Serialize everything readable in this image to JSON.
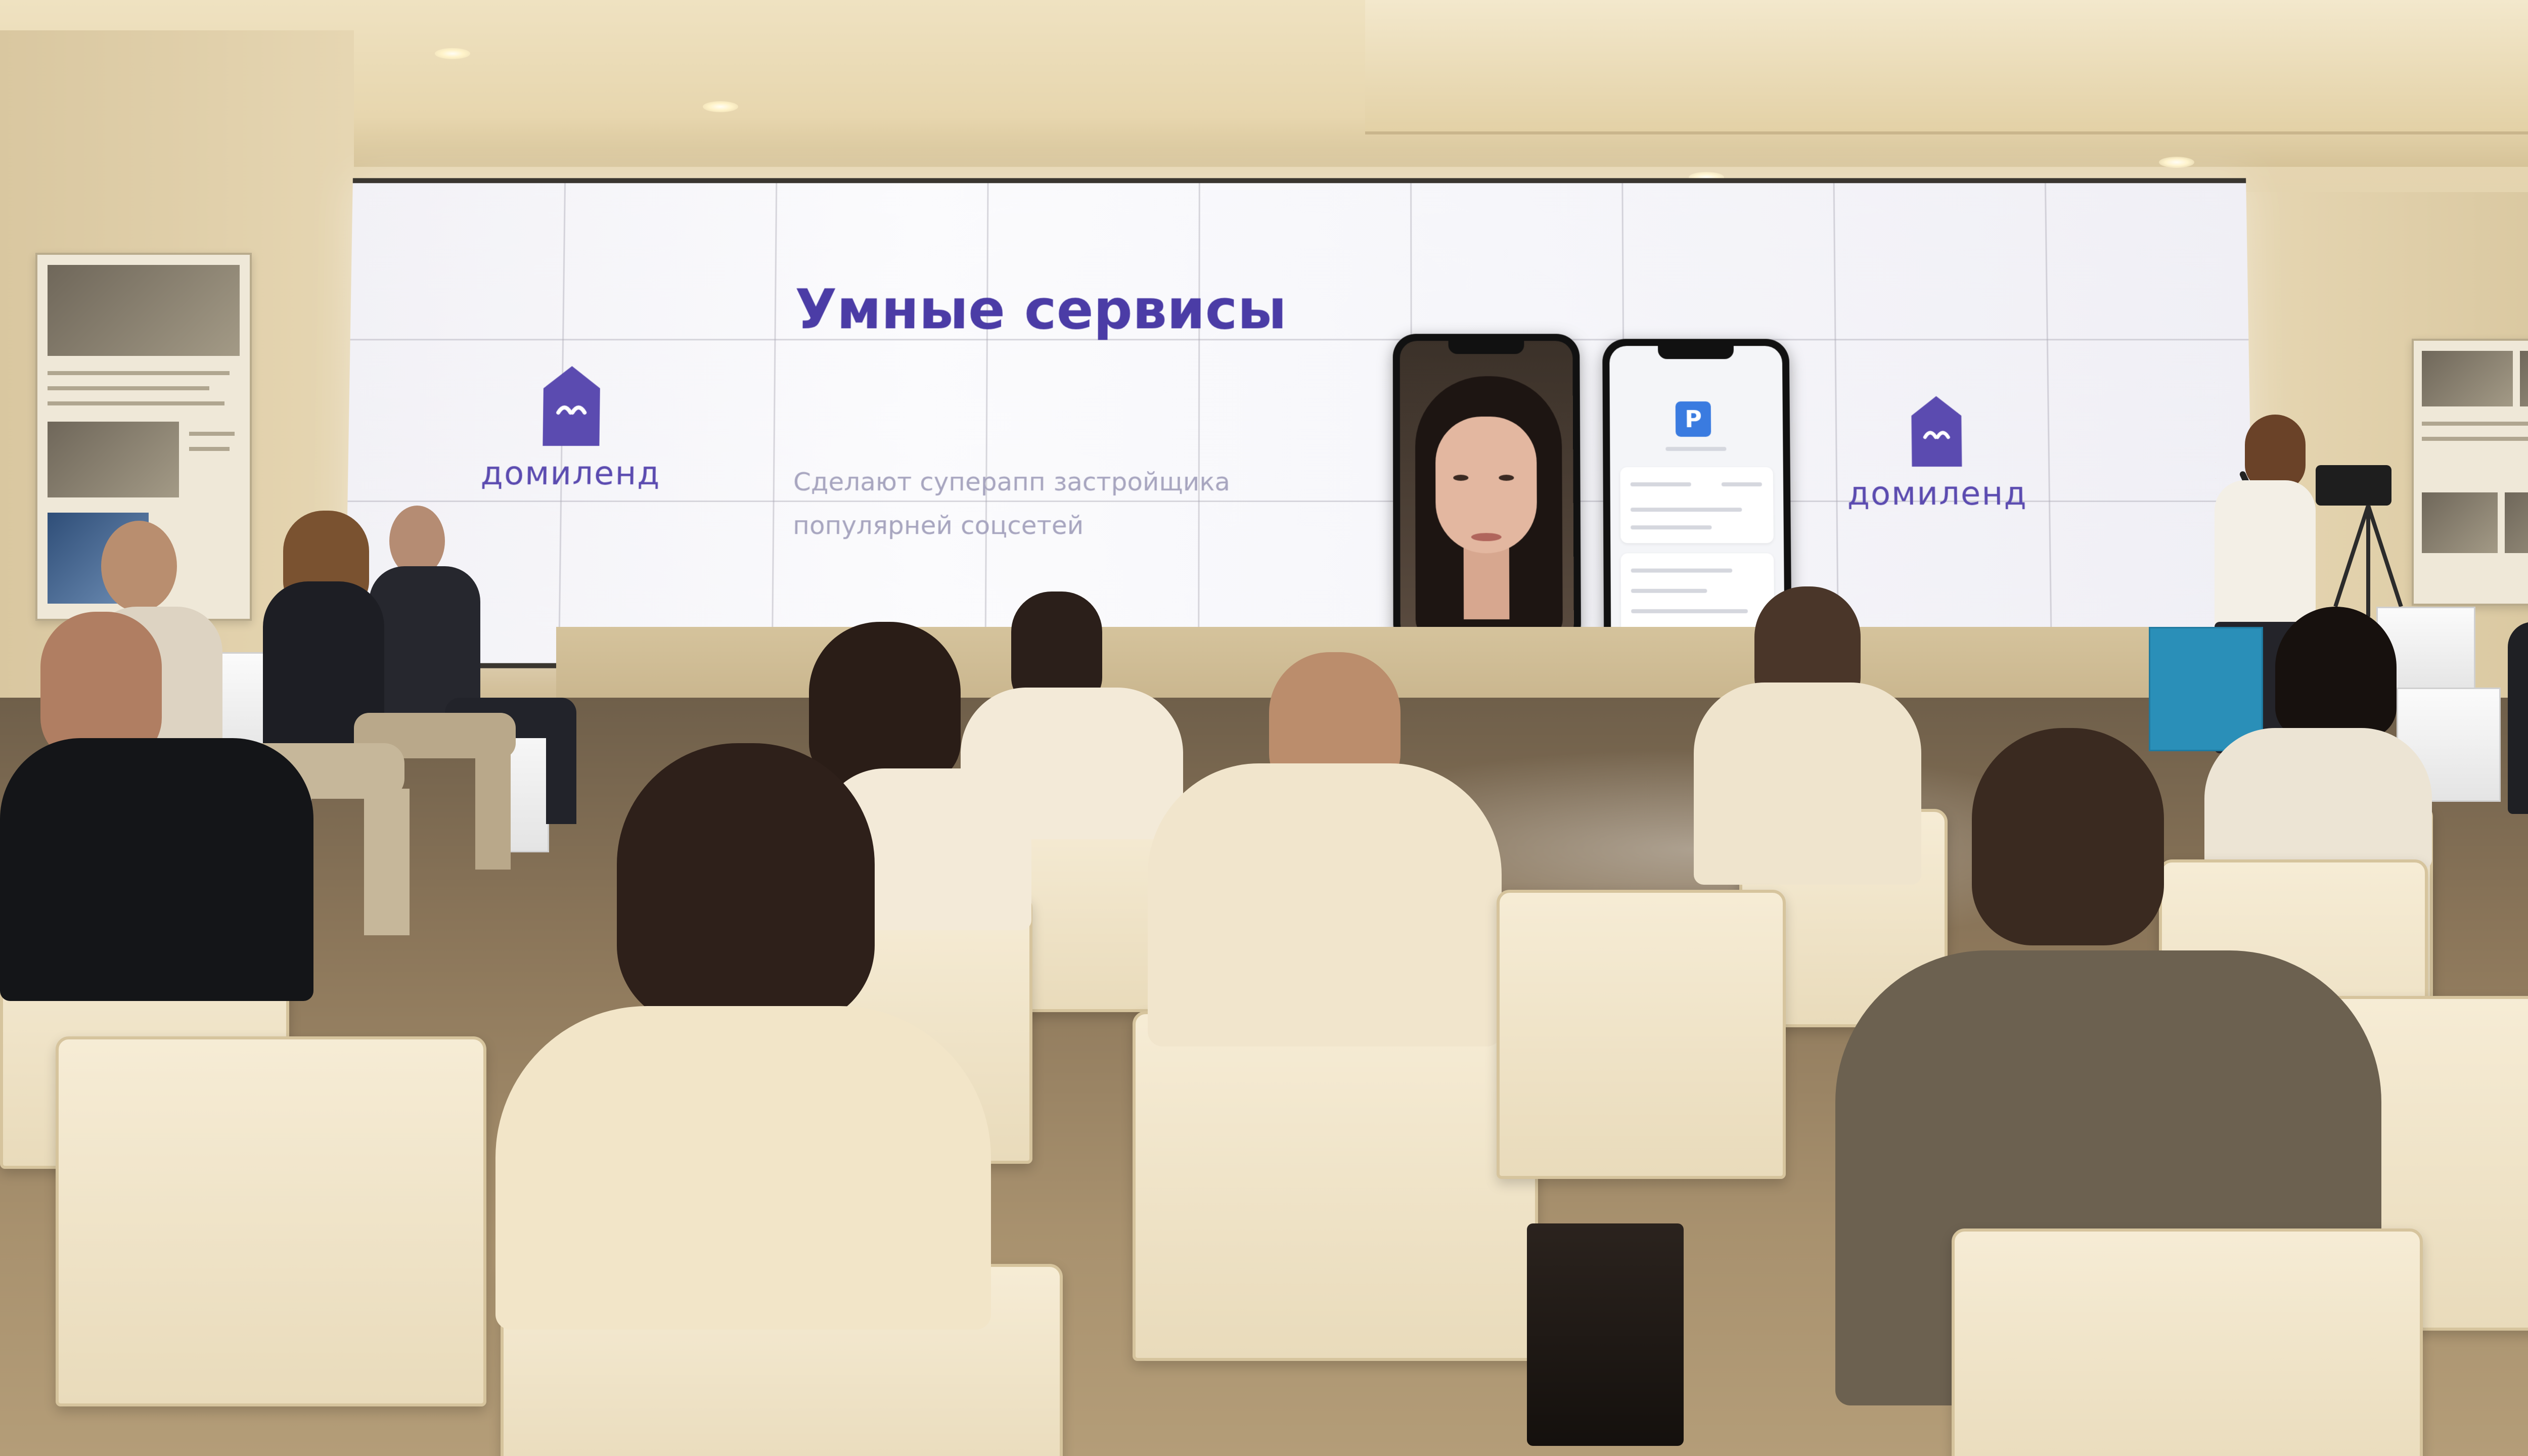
{
  "slide": {
    "title": "Умные сервисы",
    "subtitle": "Сделают суперапп застройщика популярней соцсетей",
    "logo_left": "домиленд",
    "logo_right": "домиленд",
    "phone_badge": "P"
  },
  "colors": {
    "brand_purple": "#5b4bb0",
    "title_purple": "#4b3ca6",
    "screen_white": "#f6f6fa",
    "chair_cream": "#f1e5cb"
  }
}
